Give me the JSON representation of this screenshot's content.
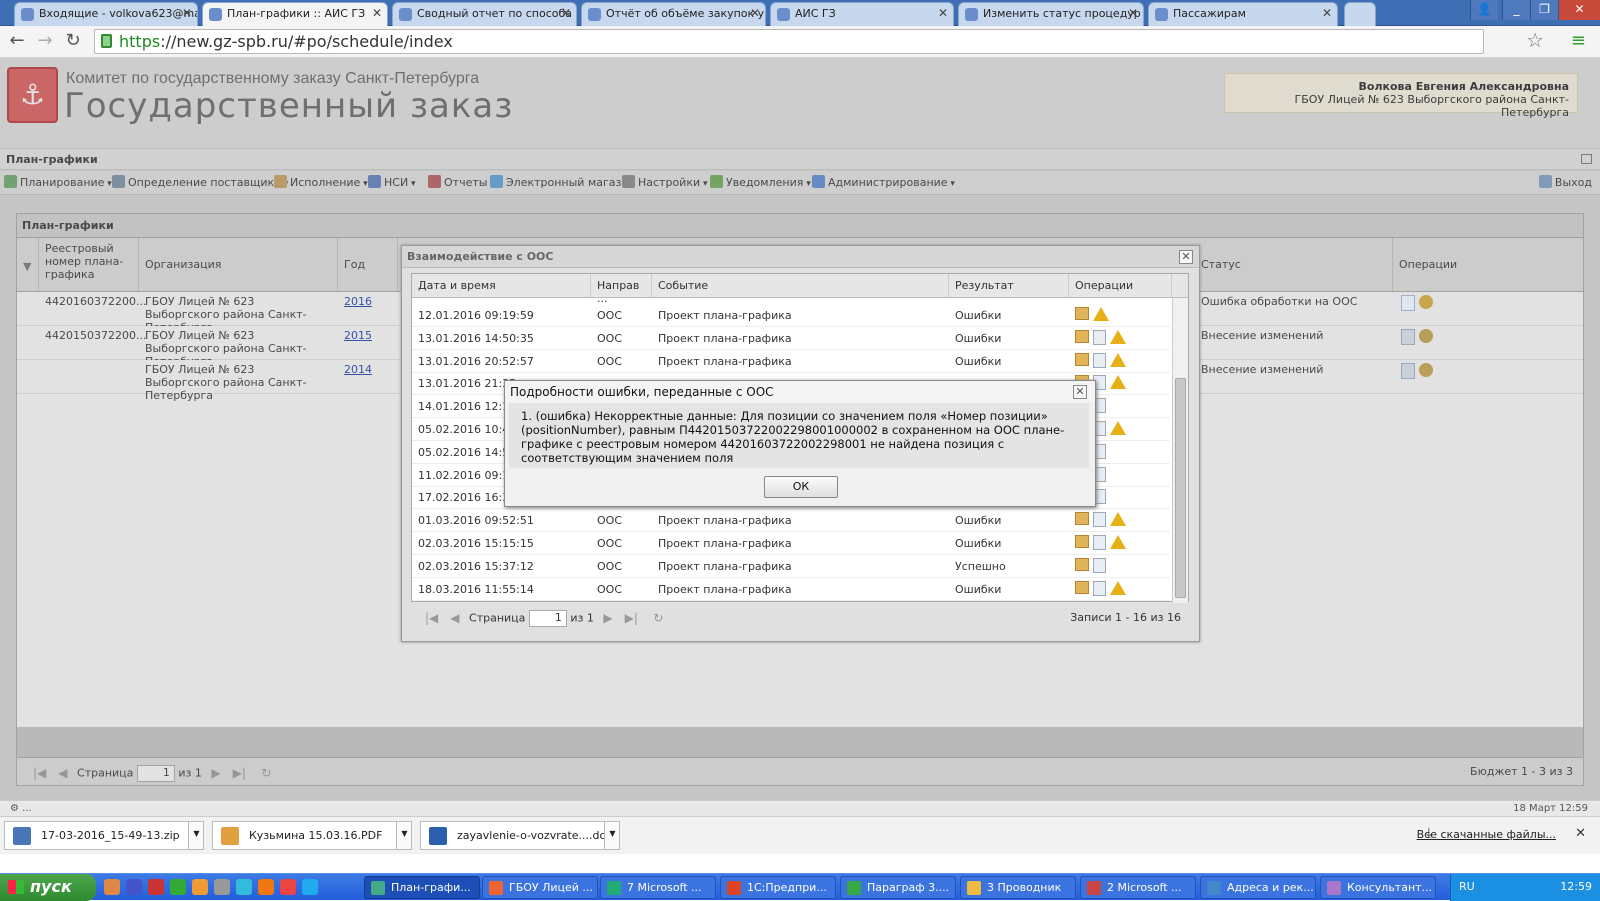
{
  "browser": {
    "tabs": [
      {
        "label": "Входящие - volkova623@ma",
        "active": false
      },
      {
        "label": "План-графики :: АИС ГЗ",
        "active": true
      },
      {
        "label": "Сводный отчет по способа",
        "active": false
      },
      {
        "label": "Отчёт об объёме закупок у",
        "active": false
      },
      {
        "label": "АИС ГЗ",
        "active": false
      },
      {
        "label": "Изменить статус процедур",
        "active": false
      },
      {
        "label": "Пассажирам",
        "active": false
      }
    ],
    "url_scheme": "https",
    "url_rest": "://new.gz-spb.ru/#po/schedule/index"
  },
  "header": {
    "subtitle": "Комитет по государственному заказу Санкт-Петербурга",
    "title": "Государственный заказ",
    "user_name": "Волкова Евгения Александровна",
    "user_org": "ГБОУ Лицей № 623 Выборгского района Санкт-Петербурга"
  },
  "page": {
    "section_title": "План-графики",
    "menu": [
      {
        "label": "Планирование",
        "dropdown": true,
        "icon": "planning-icon"
      },
      {
        "label": "Определение поставщика",
        "dropdown": true,
        "icon": "supplier-icon"
      },
      {
        "label": "Исполнение",
        "dropdown": true,
        "icon": "execution-icon"
      },
      {
        "label": "НСИ",
        "dropdown": true,
        "icon": "reference-icon"
      },
      {
        "label": "Отчеты",
        "dropdown": false,
        "icon": "reports-icon"
      },
      {
        "label": "Электронный магазин",
        "dropdown": false,
        "icon": "shop-icon"
      },
      {
        "label": "Настройки",
        "dropdown": true,
        "icon": "settings-icon"
      },
      {
        "label": "Уведомления",
        "dropdown": true,
        "icon": "notifications-icon"
      },
      {
        "label": "Администрирование",
        "dropdown": true,
        "icon": "admin-icon"
      }
    ],
    "logout_label": "Выход"
  },
  "grid": {
    "title": "План-графики",
    "columns": [
      "Реестровый номер плана-графика",
      "Организация",
      "Год",
      "Статус",
      "Операции"
    ],
    "rows": [
      {
        "reg": "4420160372200...",
        "org": "ГБОУ Лицей № 623 Выборгского района Санкт-Петербурга",
        "year": "2016",
        "status_prefix": "...",
        "status": "Ошибка обработки на ООС"
      },
      {
        "reg": "4420150372200...",
        "org": "ГБОУ Лицей № 623 Выборгского района Санкт-Петербурга",
        "year": "2015",
        "status_prefix": "...",
        "status": "Внесение изменений"
      },
      {
        "reg": "",
        "org": "ГБОУ Лицей № 623 Выборгского района Санкт-Петербурга",
        "year": "2014",
        "status_prefix": "й",
        "status": "Внесение изменений"
      }
    ],
    "footer": {
      "page_label": "Страница",
      "page": "1",
      "of_label": "из 1",
      "summary": "Бюджет 1 - 3 из 3"
    }
  },
  "interaction_dialog": {
    "title": "Взаимодействие с ООС",
    "columns": [
      "Дата и время",
      "Направ ...",
      "Событие",
      "Результат",
      "Операции"
    ],
    "rows": [
      {
        "dt": "12.01.2016 09:19:59",
        "dir": "ООС",
        "event": "Проект плана-графика",
        "result": "Ошибки",
        "ops": [
          "box",
          "warn"
        ]
      },
      {
        "dt": "13.01.2016 14:50:35",
        "dir": "ООС",
        "event": "Проект плана-графика",
        "result": "Ошибки",
        "ops": [
          "box",
          "doc",
          "warn"
        ]
      },
      {
        "dt": "13.01.2016 20:52:57",
        "dir": "ООС",
        "event": "Проект плана-графика",
        "result": "Ошибки",
        "ops": [
          "box",
          "doc",
          "warn"
        ]
      },
      {
        "dt": "13.01.2016 21:35",
        "dir": "",
        "event": "",
        "result": "",
        "ops": [
          "box",
          "doc",
          "warn"
        ]
      },
      {
        "dt": "14.01.2016 12:13",
        "dir": "",
        "event": "",
        "result": "",
        "ops": [
          "box",
          "doc"
        ]
      },
      {
        "dt": "05.02.2016 10:40",
        "dir": "",
        "event": "",
        "result": "",
        "ops": [
          "box",
          "doc",
          "warn"
        ]
      },
      {
        "dt": "05.02.2016 14:59",
        "dir": "",
        "event": "",
        "result": "",
        "ops": [
          "box",
          "doc"
        ]
      },
      {
        "dt": "11.02.2016 09:14",
        "dir": "",
        "event": "",
        "result": "",
        "ops": [
          "box",
          "doc"
        ]
      },
      {
        "dt": "17.02.2016 16:36",
        "dir": "",
        "event": "",
        "result": "",
        "ops": [
          "box",
          "doc"
        ]
      },
      {
        "dt": "01.03.2016 09:52:51",
        "dir": "ООС",
        "event": "Проект плана-графика",
        "result": "Ошибки",
        "ops": [
          "box",
          "doc",
          "warn"
        ]
      },
      {
        "dt": "02.03.2016 15:15:15",
        "dir": "ООС",
        "event": "Проект плана-графика",
        "result": "Ошибки",
        "ops": [
          "box",
          "doc",
          "warn"
        ]
      },
      {
        "dt": "02.03.2016 15:37:12",
        "dir": "ООС",
        "event": "Проект плана-графика",
        "result": "Успешно",
        "ops": [
          "box",
          "doc"
        ]
      },
      {
        "dt": "18.03.2016 11:55:14",
        "dir": "ООС",
        "event": "Проект плана-графика",
        "result": "Ошибки",
        "ops": [
          "box",
          "doc",
          "warn"
        ]
      }
    ],
    "footer": {
      "page_label": "Страница",
      "page": "1",
      "of_label": "из 1",
      "summary": "Записи 1 - 16 из 16"
    }
  },
  "error_dialog": {
    "title": "Подробности ошибки, переданные с ООС",
    "message": "1. (ошибка) Некорректные данные: Для позиции со значением поля «Номер позиции» (positionNumber), равным П44201503722002298001000002 в сохраненном на ООС плане-графике с реестровым номером 44201603722002298001 не найдена позиция с соответствующим значением поля",
    "ok_label": "ОК"
  },
  "statusbar": {
    "left": "⚙ ...",
    "right": "18 Март 12:59"
  },
  "downloads": {
    "items": [
      "17-03-2016_15-49-13.zip",
      "Кузьмина 15.03.16.PDF",
      "zayavlenie-o-vozvrate....doc"
    ],
    "all_label": "Все скачанные файлы..."
  },
  "taskbar": {
    "start_label": "пуск",
    "items": [
      {
        "label": "План-графи...",
        "active": true
      },
      {
        "label": "ГБОУ Лицей ...",
        "active": false
      },
      {
        "label": "7 Microsoft ...",
        "active": false
      },
      {
        "label": "1С:Предпри...",
        "active": false
      },
      {
        "label": "Параграф 3....",
        "active": false
      },
      {
        "label": "3 Проводник",
        "active": false
      },
      {
        "label": "2 Microsoft ...",
        "active": false
      },
      {
        "label": "Адреса и рек...",
        "active": false
      },
      {
        "label": "Консультант...",
        "active": false
      }
    ],
    "lang": "RU",
    "clock": "12:59"
  }
}
